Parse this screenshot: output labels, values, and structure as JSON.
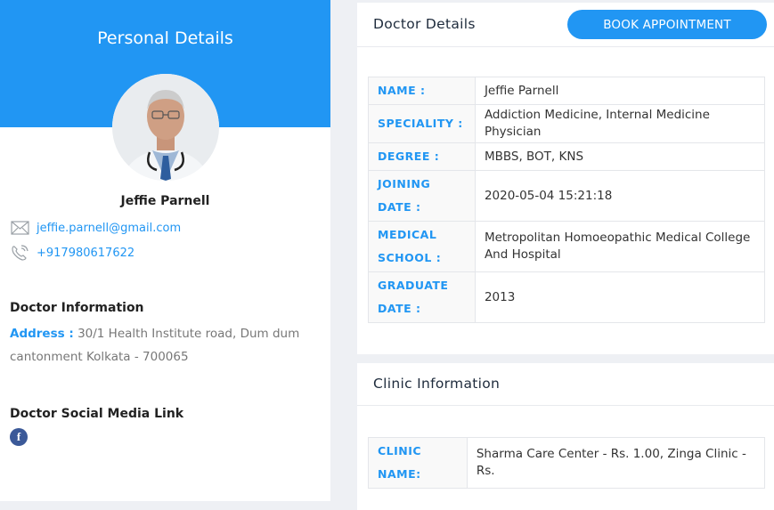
{
  "personal": {
    "header_title": "Personal Details",
    "name": "Jeffie Parnell",
    "email": "jeffie.parnell@gmail.com",
    "phone": "+917980617622",
    "doctor_info_title": "Doctor Information",
    "address_label": "Address :",
    "address_value": "30/1 Health Institute road, Dum dum cantonment Kolkata - 700065",
    "social_title": "Doctor Social Media Link",
    "social_icon": "facebook-icon",
    "accent_color": "#2196f3"
  },
  "doctor_details": {
    "title": "Doctor Details",
    "book_button": "BOOK APPOINTMENT",
    "rows": [
      {
        "label": "NAME :",
        "value": "Jeffie Parnell"
      },
      {
        "label": "SPECIALITY :",
        "value": "Addiction Medicine, Internal Medicine Physician"
      },
      {
        "label": "DEGREE :",
        "value": "MBBS, BOT, KNS"
      },
      {
        "label": "JOINING DATE :",
        "value": "2020-05-04 15:21:18"
      },
      {
        "label": "MEDICAL SCHOOL :",
        "value": "Metropolitan Homoeopathic Medical College And Hospital"
      },
      {
        "label": "GRADUATE DATE :",
        "value": "2013"
      }
    ]
  },
  "clinic": {
    "title": "Clinic Information",
    "rows": [
      {
        "label": "CLINIC NAME:",
        "value": "Sharma Care Center - Rs. 1.00, Zinga Clinic - Rs."
      }
    ]
  }
}
